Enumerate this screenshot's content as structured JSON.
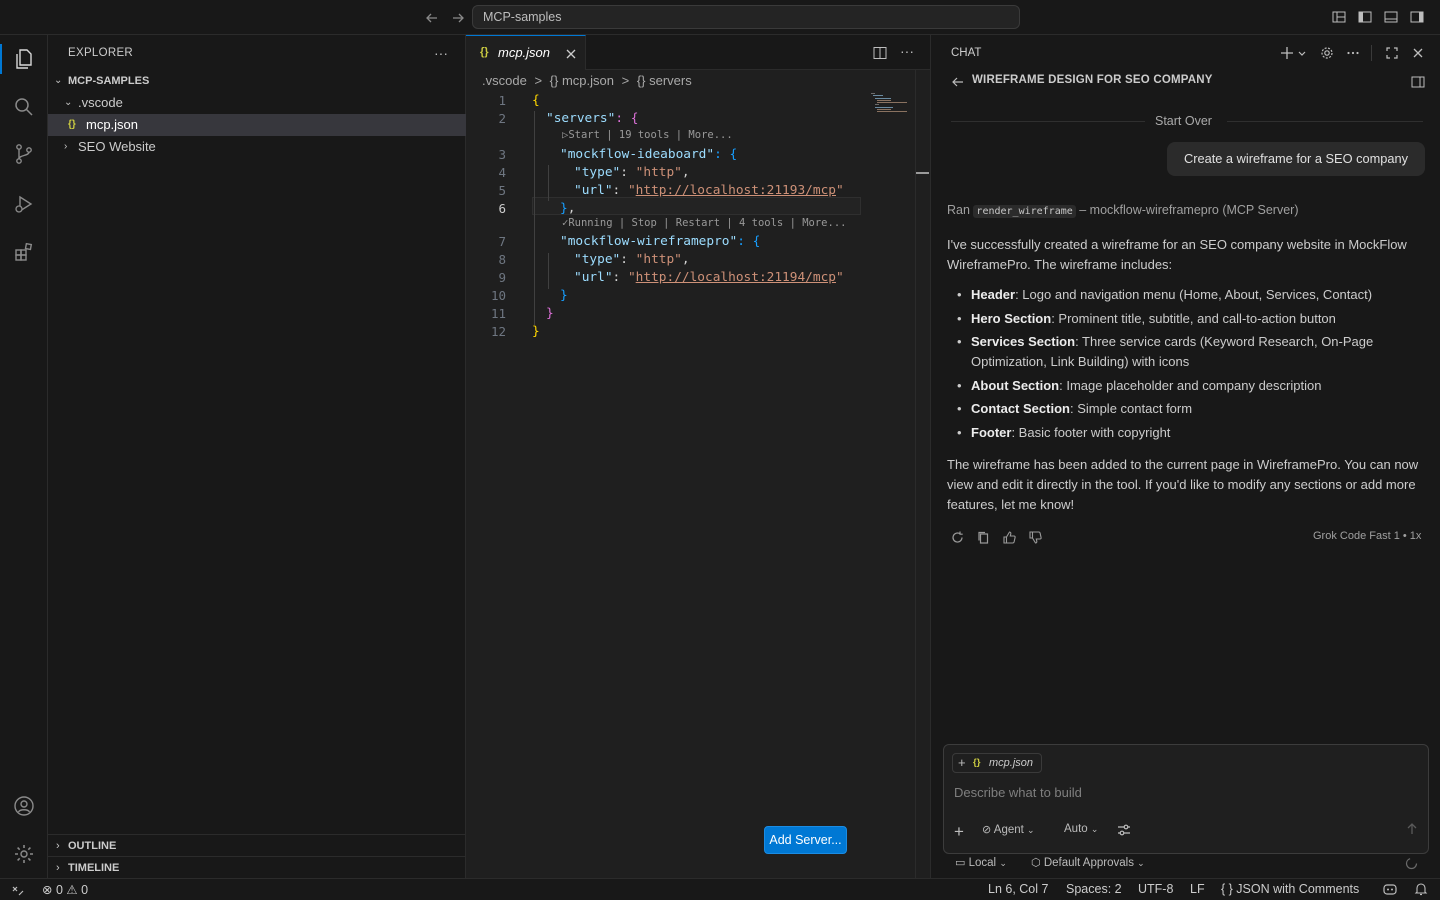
{
  "titlebar": {
    "command_center": "MCP-samples"
  },
  "sidebar": {
    "title": "EXPLORER",
    "more": "···",
    "tree": {
      "root": "MCP-SAMPLES",
      "folder_vscode": ".vscode",
      "file_mcp_icon": "{}",
      "file_mcp": "mcp.json",
      "folder_seo": "SEO Website"
    },
    "outline": "OUTLINE",
    "timeline": "TIMELINE"
  },
  "editor": {
    "tab": {
      "icon": "{}",
      "label": "mcp.json"
    },
    "more": "···",
    "breadcrumb": [
      ".vscode",
      ">",
      "{} mcp.json",
      ">",
      "{} servers"
    ],
    "line_numbers": [
      "1",
      "2",
      "3",
      "4",
      "5",
      "6",
      "7",
      "8",
      "9",
      "10",
      "11",
      "12"
    ],
    "code": {
      "l1": "{",
      "l2_key": "\"servers\"",
      "l2_rest": ": {",
      "lens1": "▷Start | 19 tools | More...",
      "l3_key": "\"mockflow-ideaboard\"",
      "l3_rest": ": {",
      "l4_key": "\"type\"",
      "l4_colon": ": ",
      "l4_val": "\"http\"",
      "l4_comma": ",",
      "l5_key": "\"url\"",
      "l5_colon": ": ",
      "l5_q1": "\"",
      "l5_url": "http://localhost:21193/mcp",
      "l5_q2": "\"",
      "l6_brace": "}",
      "l6_comma": ",",
      "lens2": "✓Running | Stop | Restart | 4 tools | More...",
      "l7_key": "\"mockflow-wireframepro\"",
      "l7_rest": ": {",
      "l8_key": "\"type\"",
      "l8_colon": ": ",
      "l8_val": "\"http\"",
      "l8_comma": ",",
      "l9_key": "\"url\"",
      "l9_colon": ": ",
      "l9_q1": "\"",
      "l9_url": "http://localhost:21194/mcp",
      "l9_q2": "\"",
      "l10": "}",
      "l11": "}",
      "l12": "}"
    },
    "add_server_button": "Add Server..."
  },
  "chat": {
    "title": "CHAT",
    "heading": "WIREFRAME DESIGN FOR SEO COMPANY",
    "start_over": "Start Over",
    "user_message": "Create a wireframe for a SEO company",
    "ran_prefix": "Ran",
    "ran_tool": "render_wireframe",
    "ran_suffix": "– mockflow-wireframepro (MCP Server)",
    "intro": "I've successfully created a wireframe for an SEO company website in MockFlow WireframePro. The wireframe includes:",
    "bullets": [
      {
        "title": "Header",
        "text": ": Logo and navigation menu (Home, About, Services, Contact)"
      },
      {
        "title": "Hero Section",
        "text": ": Prominent title, subtitle, and call-to-action button"
      },
      {
        "title": "Services Section",
        "text": ": Three service cards (Keyword Research, On-Page Optimization, Link Building) with icons"
      },
      {
        "title": "About Section",
        "text": ": Image placeholder and company description"
      },
      {
        "title": "Contact Section",
        "text": ": Simple contact form"
      },
      {
        "title": "Footer",
        "text": ": Basic footer with copyright"
      }
    ],
    "outro": "The wireframe has been added to the current page in WireframePro. You can now view and edit it directly in the tool. If you'd like to modify any sections or add more features, let me know!",
    "model": "Grok Code Fast 1 • 1x",
    "input": {
      "context_icon": "{}",
      "context_file": "mcp.json",
      "placeholder": "Describe what to build",
      "agent": "Agent",
      "auto": "Auto",
      "local": "Local",
      "approvals": "Default Approvals"
    }
  },
  "statusbar": {
    "errors": "0",
    "warnings": "0",
    "position": "Ln 6, Col 7",
    "spaces": "Spaces: 2",
    "encoding": "UTF-8",
    "eol": "LF",
    "language": "{ }  JSON with Comments"
  }
}
